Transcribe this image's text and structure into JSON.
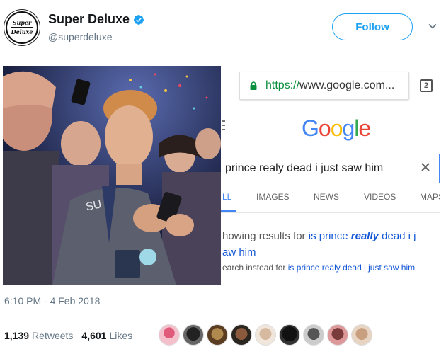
{
  "author": {
    "name": "Super Deluxe",
    "handle": "@superdeluxe",
    "avatar_text_top": "Super",
    "avatar_text_bottom": "Deluxe",
    "verified": true,
    "verified_icon": "verified-badge-icon"
  },
  "actions": {
    "follow_label": "Follow",
    "more_icon": "chevron-down-icon"
  },
  "phone_screenshot": {
    "url_scheme": "https://",
    "url_rest": "www.google.com...",
    "tab_count": "2",
    "logo": [
      "G",
      "o",
      "o",
      "g",
      "l",
      "e"
    ],
    "query": "prince realy dead i just saw him",
    "tabs": [
      "LL",
      "IMAGES",
      "NEWS",
      "VIDEOS",
      "MAPS"
    ],
    "showing_prefix": "howing results for ",
    "showing_link_a": "is prince ",
    "showing_link_em": "really",
    "showing_link_b": " dead i j",
    "showing_line2": "aw him",
    "instead_prefix": "earch instead for ",
    "instead_link": "is prince realy dead i just saw him",
    "colors": {
      "blue": "#4285f4",
      "red": "#ea4335",
      "yellow": "#fbbc05",
      "green": "#34a853",
      "link": "#1558d6"
    }
  },
  "footer": {
    "timestamp": "6:10 PM - 4 Feb 2018",
    "retweets_count": "1,139",
    "retweets_label": "Retweets",
    "likes_count": "4,601",
    "likes_label": "Likes",
    "likers_count": 9
  },
  "colors": {
    "accent": "#1da1f2",
    "muted": "#657786",
    "text": "#14171a"
  }
}
